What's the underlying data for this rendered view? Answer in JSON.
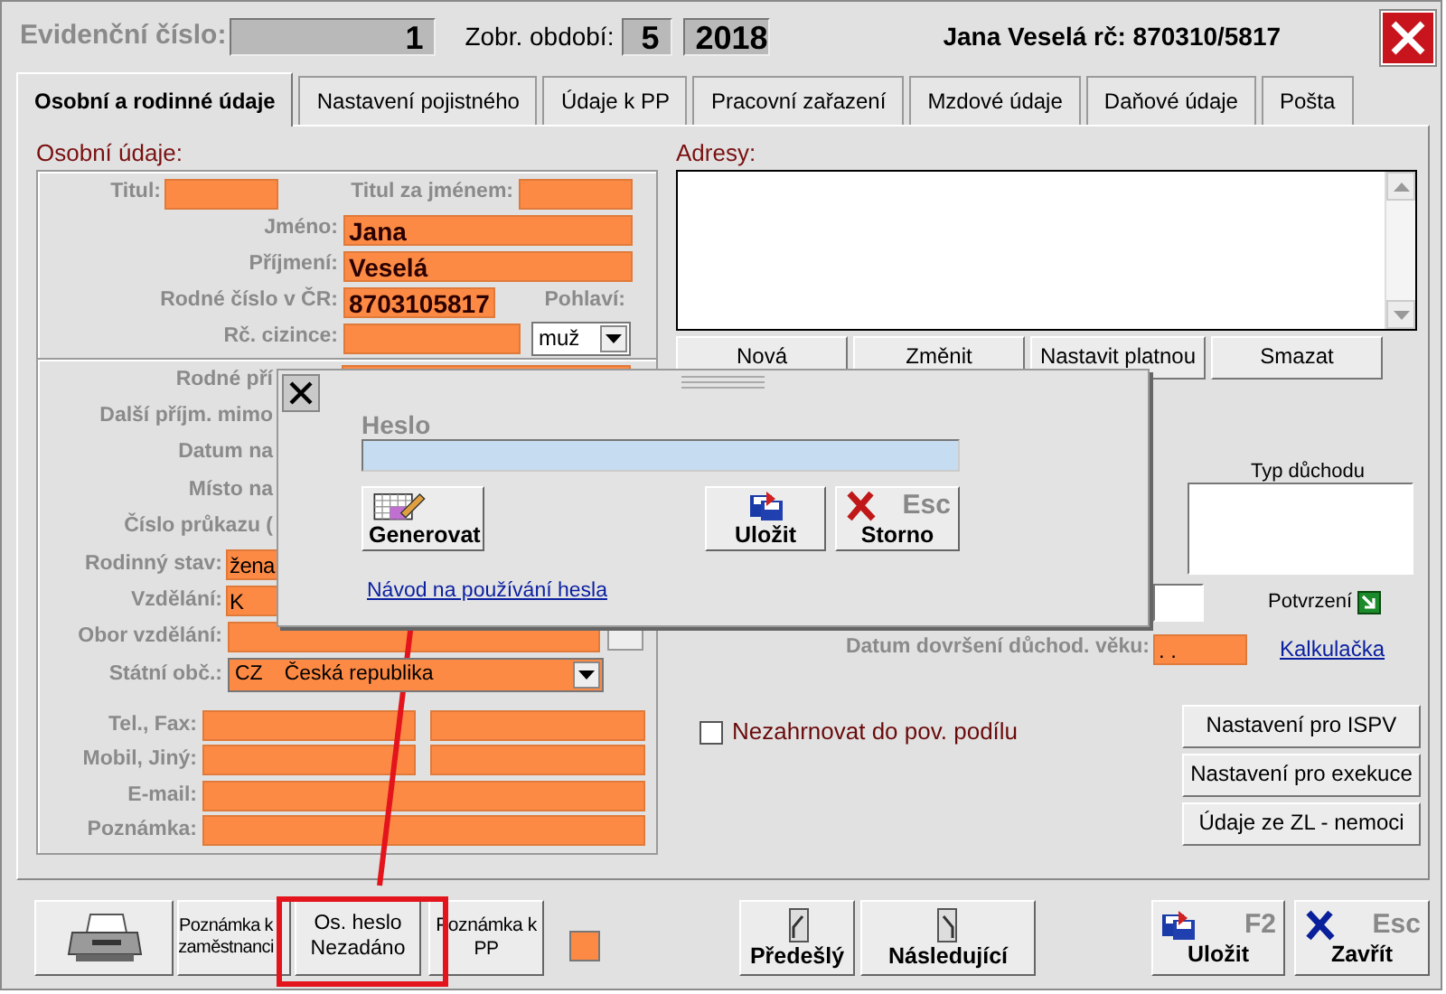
{
  "header": {
    "evidence_label": "Evidenční číslo:",
    "evidence_number": "1",
    "period_label": "Zobr. období:",
    "period_month": "5",
    "period_year": "2018",
    "employee": "Jana Veselá rč: 870310/5817"
  },
  "tabs": [
    {
      "label": "Osobní a rodinné údaje",
      "selected": true
    },
    {
      "label": "Nastavení pojistného",
      "selected": false
    },
    {
      "label": "Údaje k PP",
      "selected": false
    },
    {
      "label": "Pracovní zařazení",
      "selected": false
    },
    {
      "label": "Mzdové údaje",
      "selected": false
    },
    {
      "label": "Daňové údaje",
      "selected": false
    },
    {
      "label": "Pošta",
      "selected": false
    }
  ],
  "personal": {
    "heading": "Osobní údaje:",
    "title_before": {
      "label": "Titul:"
    },
    "title_after": {
      "label": "Titul za jménem:"
    },
    "first_name": {
      "label": "Jméno:",
      "value": "Jana"
    },
    "surname": {
      "label": "Příjmení:",
      "value": "Veselá"
    },
    "birth_number": {
      "label": "Rodné číslo v ČR:",
      "value": "8703105817"
    },
    "gender": {
      "label": "Pohlaví:",
      "value": "muž"
    },
    "foreign_birth_number": {
      "label": "Rč. cizince:"
    },
    "covered_rows": [
      {
        "label": "Rodné pří"
      },
      {
        "label": "Další příjm. mimo"
      },
      {
        "label": "Datum na"
      },
      {
        "label": "Místo na"
      },
      {
        "label": "Číslo průkazu ("
      }
    ],
    "marital_status": {
      "label": "Rodinný stav:",
      "value": "žena"
    },
    "education": {
      "label": "Vzdělání:",
      "value": "K"
    },
    "field_of_study": {
      "label": "Obor vzdělání:"
    },
    "citizenship": {
      "label": "Státní obč.:",
      "code": "CZ",
      "value": "Česká republika"
    },
    "contacts": [
      {
        "label": "Tel., Fax:",
        "kind": "double"
      },
      {
        "label": "Mobil, Jiný:",
        "kind": "double"
      },
      {
        "label": "E-mail:",
        "kind": "single"
      },
      {
        "label": "Poznámka:",
        "kind": "single"
      }
    ]
  },
  "addresses": {
    "heading": "Adresy:",
    "buttons": [
      "Nová",
      "Změnit",
      "Nastavit platnou",
      "Smazat"
    ]
  },
  "pension": {
    "type_label": "Typ důchodu",
    "confirm_label": "Potvrzení",
    "retirement_label": "Datum dovršení důchod. věku:",
    "retirement_value": ". .",
    "calculator_link": "Kalkulačka"
  },
  "exclude": {
    "label": "Nezahrnovat do pov. podílu",
    "checked": false
  },
  "side_buttons": [
    "Nastavení pro ISPV",
    "Nastavení pro exekuce",
    "Údaje ze ZL - nemoci"
  ],
  "bottom_bar": {
    "note_employee": "Poznámka k zaměstnanci",
    "password": {
      "title": "Os. heslo",
      "status": "Nezadáno"
    },
    "note_pp": "Poznámka k PP",
    "previous": "Předešlý",
    "next": "Následující",
    "save": {
      "label": "Uložit",
      "shortcut": "F2"
    },
    "close": {
      "label": "Zavřít",
      "shortcut": "Esc"
    }
  },
  "password_dialog": {
    "label": "Heslo",
    "generate": "Generovat",
    "save": "Uložit",
    "cancel": {
      "label": "Storno",
      "shortcut": "Esc"
    },
    "help_link": "Návod na používání hesla"
  }
}
